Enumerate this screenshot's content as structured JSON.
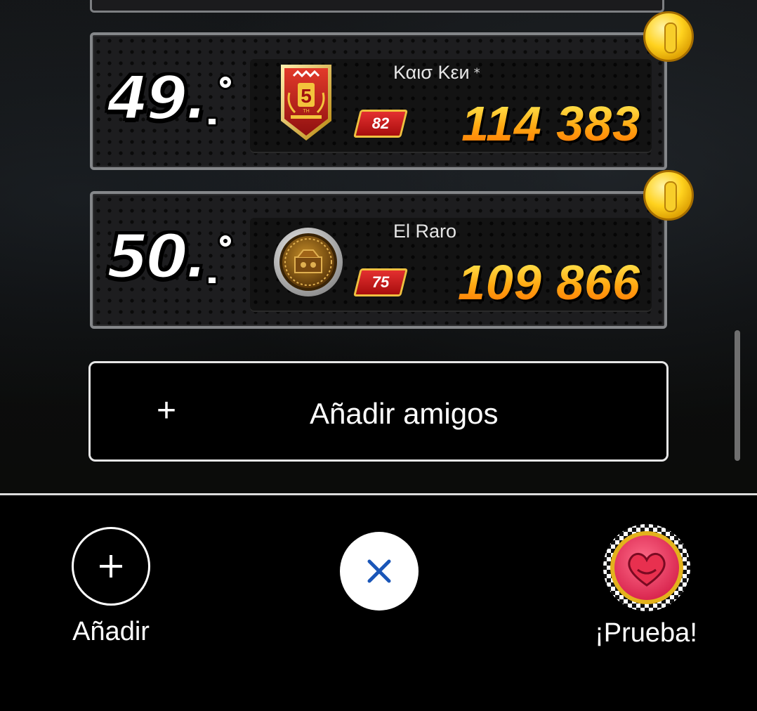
{
  "leaderboard": {
    "entries": [
      {
        "rank": "49.",
        "player_name": "Καισ Κεи",
        "name_suffix": "⁎",
        "level": "82",
        "score": "114 383",
        "emblem_icon": "anniversary-5th-shield-icon",
        "reward_icon": "coin-icon"
      },
      {
        "rank": "50.",
        "player_name": "El Raro",
        "name_suffix": "",
        "level": "75",
        "score": "109 866",
        "emblem_icon": "mario-kart-bronze-medal-icon",
        "reward_icon": "coin-icon"
      }
    ],
    "add_friends_label": "Añadir amigos",
    "add_friends_icon": "plus-icon"
  },
  "bottom_bar": {
    "add_label": "Añadir",
    "add_icon": "plus-icon",
    "close_icon": "close-icon",
    "try_label": "¡Prueba!",
    "try_icon": "mario-kart-heart-emblem-icon"
  },
  "colors": {
    "score_gradient_top": "#ffe24a",
    "score_gradient_bottom": "#ff7a06",
    "close_x": "#1a56b8",
    "level_badge_red": "#d42020",
    "coin_gold": "#ffd21e"
  }
}
